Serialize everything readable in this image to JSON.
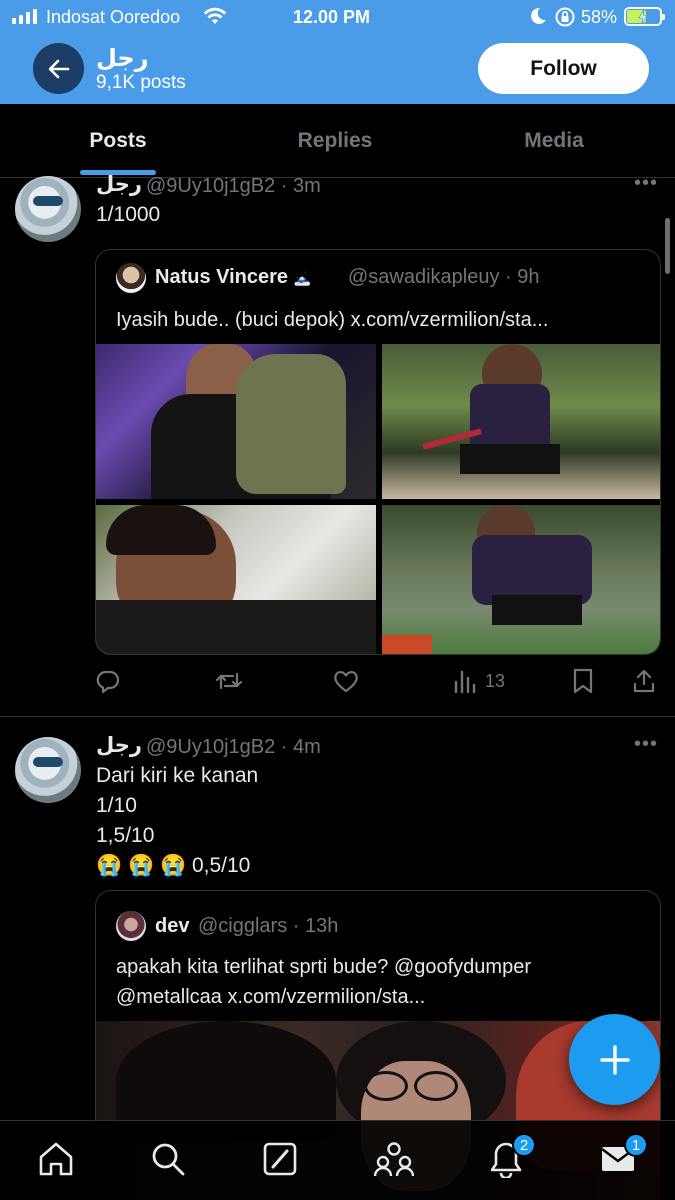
{
  "status_bar": {
    "carrier": "Indosat Ooredoo",
    "time": "12.00 PM",
    "battery": "58%",
    "battery_level": 0.58
  },
  "header": {
    "name": "رجل",
    "post_count": "9,1K posts",
    "follow_label": "Follow",
    "bg_color": "#4a9ce8"
  },
  "tabs": [
    {
      "label": "Posts",
      "active": true
    },
    {
      "label": "Replies",
      "active": false
    },
    {
      "label": "Media",
      "active": false
    }
  ],
  "posts": [
    {
      "name": "رجل",
      "handle": "@9Uy10j1gB2 · 3m",
      "text": "1/1000",
      "quote": {
        "name": "Natus Vincere",
        "emoji": "🗻",
        "handle": "@sawadikapleuy · 9h",
        "text": "Iyasih bude.. (buci depok) x.com/vzermilion/sta..."
      },
      "views": "13"
    },
    {
      "name": "رجل",
      "handle": "@9Uy10j1gB2 · 4m",
      "lines": [
        "Dari kiri ke kanan",
        "1/10",
        "1,5/10",
        "😭 😭 😭 0,5/10"
      ],
      "quote": {
        "name": "dev",
        "handle": "@cigglars · 13h",
        "text_lines": [
          "apakah kita terlihat sprti bude? @goofydumper",
          "@metallcaa x.com/vzermilion/sta..."
        ]
      }
    }
  ],
  "bottom_nav": {
    "notifications_badge": "2",
    "messages_badge": "1"
  },
  "colors": {
    "accent": "#1d9bf0",
    "muted": "#71767b",
    "border": "#2f3336"
  }
}
